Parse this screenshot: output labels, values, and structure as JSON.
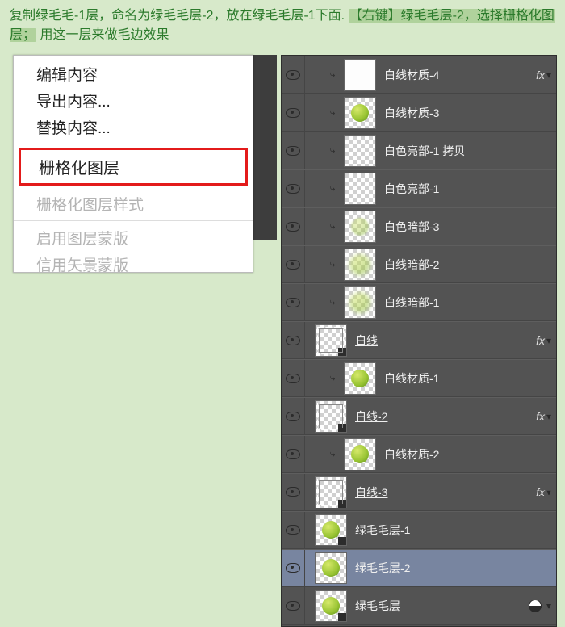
{
  "instruction": {
    "pre": "复制绿毛毛-1层，命名为绿毛毛层-2，放在绿毛毛层-1下面.",
    "hl": "【右键】绿毛毛层-2，选择栅格化图层；",
    "post": "用这一层来做毛边效果"
  },
  "context_menu": {
    "items": [
      "编辑内容",
      "导出内容...",
      "替换内容..."
    ],
    "highlight": "栅格化图层",
    "items_after": [
      "栅格化图层样式"
    ],
    "disabled": [
      "启用图层蒙版",
      "信用矢景蒙版"
    ]
  },
  "layers": [
    {
      "name": "白线材质-4",
      "thumb": "white",
      "fx": true,
      "indent": 1,
      "arrow": true
    },
    {
      "name": "白线材质-3",
      "thumb": "ball",
      "indent": 1,
      "arrow": true
    },
    {
      "name": "白色亮部-1 拷贝",
      "thumb": "checker",
      "indent": 1,
      "arrow": true
    },
    {
      "name": "白色亮部-1",
      "thumb": "checker",
      "indent": 1,
      "arrow": true
    },
    {
      "name": "白色暗部-3",
      "thumb": "checker-dim",
      "indent": 1,
      "arrow": true
    },
    {
      "name": "白线暗部-2",
      "thumb": "checker-blur",
      "indent": 1,
      "arrow": true
    },
    {
      "name": "白线暗部-1",
      "thumb": "checker-blur",
      "indent": 1,
      "arrow": true
    },
    {
      "name": "白线",
      "thumb": "outline",
      "fx": true,
      "indent": 0,
      "underline": true,
      "smart": true
    },
    {
      "name": "白线材质-1",
      "thumb": "ball",
      "indent": 1,
      "arrow": true
    },
    {
      "name": "白线-2",
      "thumb": "outline",
      "fx": true,
      "indent": 0,
      "underline": true,
      "smart": true
    },
    {
      "name": "白线材质-2",
      "thumb": "ball",
      "indent": 1,
      "arrow": true
    },
    {
      "name": "白线-3",
      "thumb": "outline",
      "fx": true,
      "indent": 0,
      "underline": true,
      "smart": true
    },
    {
      "name": "绿毛毛层-1",
      "thumb": "ball-smart",
      "indent": 0,
      "smart": true
    },
    {
      "name": "绿毛毛层-2",
      "thumb": "ball-sel",
      "indent": 0,
      "selected": true
    },
    {
      "name": "绿毛毛层",
      "thumb": "ball-smart",
      "indent": 0,
      "smart": true,
      "filter": true
    }
  ],
  "fx_label": "fx"
}
